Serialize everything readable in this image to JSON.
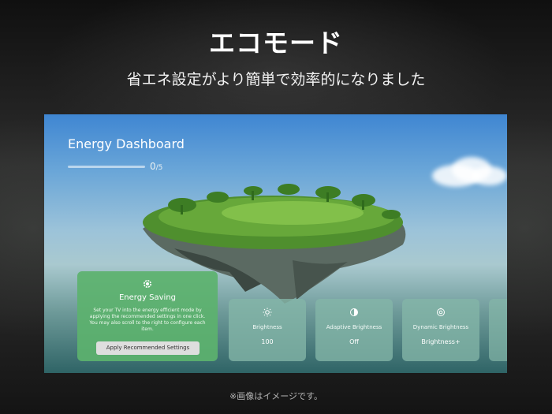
{
  "heading": "エコモード",
  "subheading": "省エネ設定がより簡単で効率的になりました",
  "footnote": "※画像はイメージです。",
  "dashboard": {
    "title": "Energy Dashboard",
    "progress_current": "0",
    "progress_total": "/5",
    "progress_fraction": 0.0
  },
  "energy_saving": {
    "icon": "leaf-gear-icon",
    "title": "Energy Saving",
    "description": "Set your TV into the energy efficient mode by applying the recommended settings in one click. You may also scroll to the right to configure each item.",
    "button_label": "Apply Recommended Settings"
  },
  "settings": [
    {
      "icon": "sun-icon",
      "label": "Brightness",
      "value": "100"
    },
    {
      "icon": "adaptive-brightness-icon",
      "label": "Adaptive Brightness",
      "value": "Off"
    },
    {
      "icon": "dynamic-brightness-icon",
      "label": "Dynamic Brightness",
      "value": "Brightness+"
    }
  ],
  "colors": {
    "energy_card": "#5cb26e",
    "setting_card": "#84b6a8",
    "sky_top": "#3f86d2",
    "button": "#dedede"
  }
}
